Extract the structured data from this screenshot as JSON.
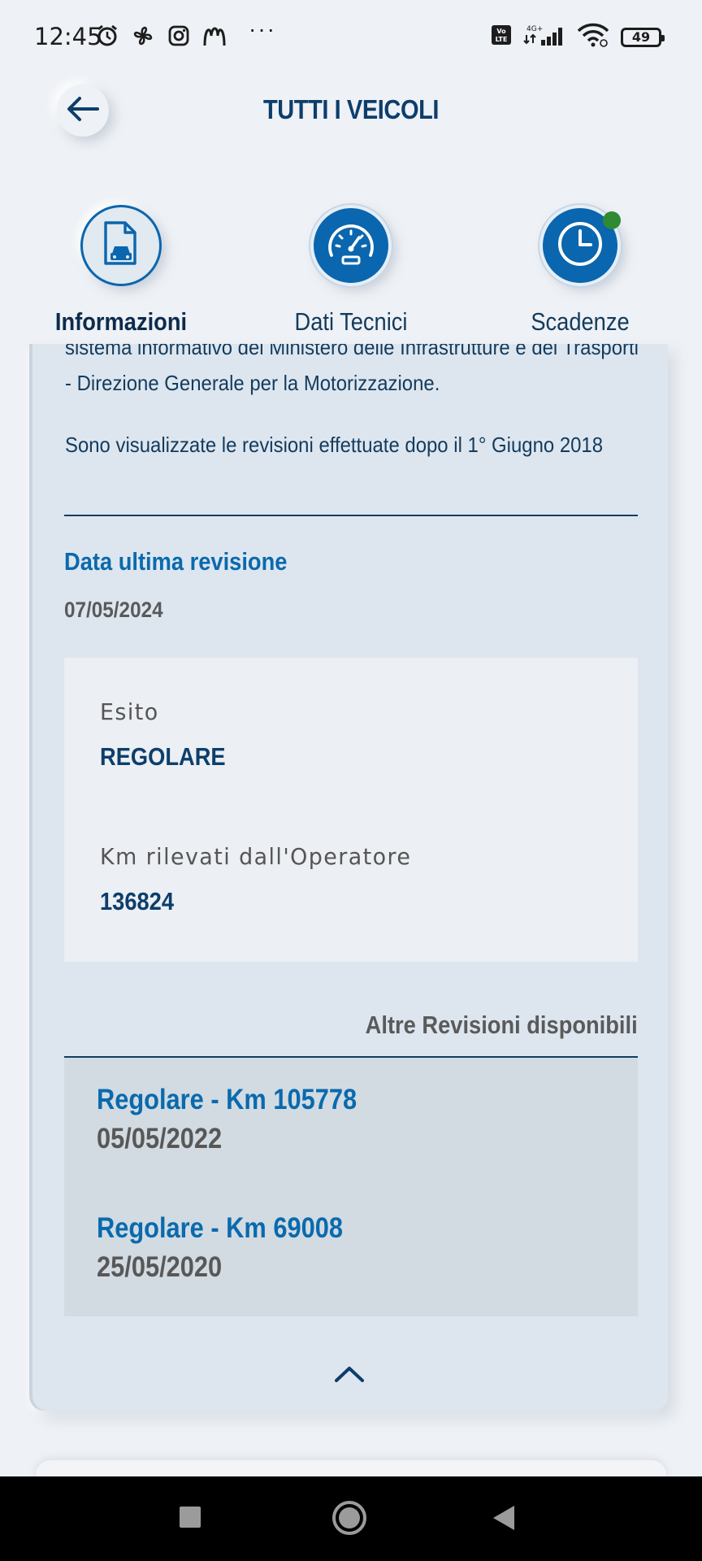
{
  "status_bar": {
    "time": "12:45",
    "battery": "49",
    "network": "4G+",
    "volte": "Vo LTE",
    "more": "···"
  },
  "header": {
    "title": "TUTTI I VEICOLI"
  },
  "tabs": [
    {
      "label": "Informazioni",
      "icon": "document-car-icon",
      "selected": true
    },
    {
      "label": "Dati Tecnici",
      "icon": "speedometer-icon",
      "selected": false
    },
    {
      "label": "Scadenze",
      "icon": "clock-icon",
      "selected": false,
      "notification": true
    }
  ],
  "card": {
    "intro_paragraph_1": "sistema informativo del Ministero delle Infrastrutture e dei Trasporti - Direzione Generale per la Motorizzazione.",
    "intro_paragraph_2": "Sono visualizzate le revisioni effettuate dopo il 1° Giugno 2018",
    "last_revision_title": "Data ultima revisione",
    "last_revision_date": "07/05/2024",
    "result": {
      "esito_label": "Esito",
      "esito_value": "REGOLARE",
      "km_label": "Km rilevati dall'Operatore",
      "km_value": "136824"
    },
    "others_title": "Altre Revisioni disponibili",
    "other_revisions": [
      {
        "title": "Regolare - Km 105778",
        "date": "05/05/2022"
      },
      {
        "title": "Regolare - Km 69008",
        "date": "25/05/2020"
      }
    ]
  },
  "colors": {
    "accent_blue": "#0a66ae",
    "title_navy": "#0d3e6b",
    "card_bg": "#dde6ef",
    "notification_green": "#2f8a34"
  }
}
